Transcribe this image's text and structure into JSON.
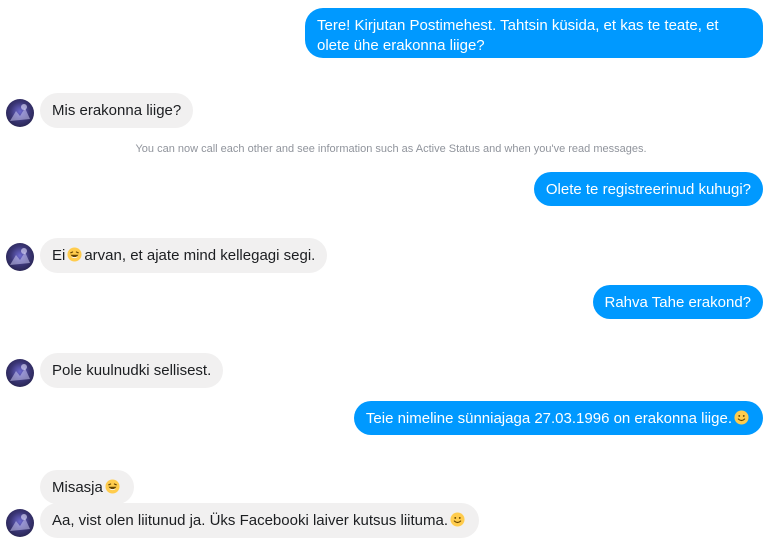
{
  "messages": {
    "m1": "Tere! Kirjutan Postimehest. Tahtsin küsida, et kas te teate, et olete ühe erakonna liige?",
    "m2": "Mis erakonna liige?",
    "system_notice": "You can now call each other and see information such as Active Status and when you've read messages.",
    "m3": "Olete te registreerinud kuhugi?",
    "m4_a": "Ei",
    "m4_b": "arvan, et ajate mind kellegagi segi.",
    "m5": "Rahva Tahe erakond?",
    "m6": "Pole kuulnudki sellisest.",
    "m7": "Teie nimeline sünniajaga 27.03.1996 on erakonna liige.",
    "m8": "Misasja",
    "m9": "Aa, vist olen liitunud ja. Üks Facebooki laiver kutsus liituma."
  },
  "icons": {
    "laughing": "laughing-emoji-icon",
    "smiley": "smiley-emoji-icon",
    "avatar": "contact-avatar"
  },
  "colors": {
    "outgoing_bubble": "#0099ff",
    "incoming_bubble": "#f1f0f0",
    "system_text": "#90949c"
  }
}
